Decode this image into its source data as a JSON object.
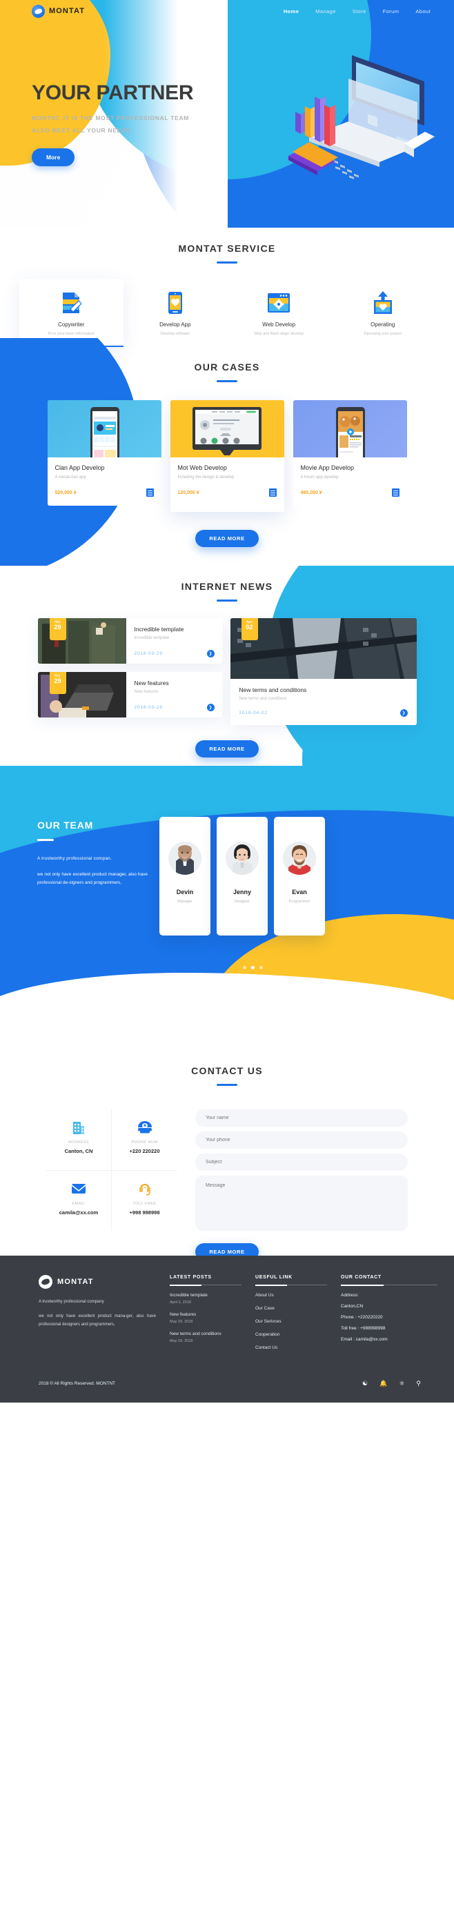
{
  "nav": {
    "brand": "MONTAT",
    "links": [
      {
        "label": "Home",
        "active": true
      },
      {
        "label": "Manage",
        "active": false
      },
      {
        "label": "Store",
        "active": false
      },
      {
        "label": "Forum",
        "active": false
      },
      {
        "label": "About",
        "active": false
      }
    ]
  },
  "hero": {
    "title": "YOUR PARTNER",
    "sub_line1": "MONTNT, IT IS THE MOST PROFESSIONAL TEAM",
    "sub_line2": "ALSO MEET ALL YOUR NEEDS",
    "button": "More"
  },
  "service": {
    "title": "MONTAT SERVICE",
    "items": [
      {
        "name": "Copywriter",
        "desc": "Fil in your basic information",
        "icon": "document-pencil-icon",
        "active": true
      },
      {
        "name": "Develop App",
        "desc": "Develop software",
        "icon": "mobile-heart-icon",
        "active": false
      },
      {
        "name": "Web Develop",
        "desc": "Web and Back-stage develop",
        "icon": "browser-gear-icon",
        "active": false
      },
      {
        "name": "Operating",
        "desc": "Operating your project",
        "icon": "upload-heart-icon",
        "active": false
      }
    ]
  },
  "cases": {
    "title": "OUR CASES",
    "read_more": "READ MORE",
    "items": [
      {
        "title": "Clan App Develop",
        "desc": "A social-clan app",
        "price": "520,000 ¥",
        "bg": "#4ab8e8",
        "feature": false
      },
      {
        "title": "Mot Web Develop",
        "desc": "Including the design & develop",
        "price": "120,000 ¥",
        "bg": "#fcc42a",
        "feature": true
      },
      {
        "title": "Movie App Develop",
        "desc": "A forum app develop",
        "price": "480,000 ¥",
        "bg": "#7b9cf0",
        "feature": false
      }
    ]
  },
  "news": {
    "title": "INTERNET NEWS",
    "read_more": "READ MORE",
    "small": [
      {
        "title": "Incredible template",
        "desc": "Incredible template",
        "date": "2018-03-29",
        "tag_month": "Mar",
        "tag_day": "29"
      },
      {
        "title": "New features",
        "desc": "New features",
        "date": "2018-03-29",
        "tag_month": "Mar",
        "tag_day": "29"
      }
    ],
    "big": {
      "title": "New terms and conditions",
      "desc": "New terms and conditions",
      "date": "2018-04-02",
      "tag_month": "Apri",
      "tag_day": "02"
    }
  },
  "team": {
    "title": "OUR TEAM",
    "p1": "A trustworthy professional compan.",
    "p2": "we not only have excellent product manager, also have professional de-signers and programmers,",
    "members": [
      {
        "name": "Devin",
        "role": "Manager"
      },
      {
        "name": "Jenny",
        "role": "Designer"
      },
      {
        "name": "Evan",
        "role": "Programmer"
      }
    ],
    "dots": [
      false,
      true,
      false
    ]
  },
  "contact": {
    "title": "CONTACT US",
    "info": [
      {
        "label": "ADDRESS",
        "value": "Canton, CN",
        "icon": "building-icon",
        "color": "#4ab8e8"
      },
      {
        "label": "PHONE NUM",
        "value": "+220 220220",
        "icon": "telephone-icon",
        "color": "#1a73e8"
      },
      {
        "label": "EMAIL",
        "value": "camila@xx.com",
        "icon": "envelope-icon",
        "color": "#1a73e8"
      },
      {
        "label": "TOLL FREE",
        "value": "+998 998998",
        "icon": "headset-icon",
        "color": "#f5a623"
      }
    ],
    "form": {
      "name_placeholder": "Your name",
      "phone_placeholder": "Your phone",
      "subject_placeholder": "Subject",
      "message_placeholder": "Message",
      "submit": "READ MORE"
    }
  },
  "footer": {
    "brand": "MONTAT",
    "p1": "A trustworthy professional company",
    "p2": "we not only have excellent product mana-ger, also have professional designers and programmers,",
    "latest_posts_title": "LATEST POSTS",
    "latest_posts": [
      {
        "title": "Incredible template",
        "date": "April 2, 2018"
      },
      {
        "title": "New features",
        "date": "May 29, 2018"
      },
      {
        "title": "New terms and conditions",
        "date": "May 29, 2018"
      }
    ],
    "useful_link_title": "UESFUL LINK",
    "useful_links": [
      "About Us",
      "Our Case",
      "Our Serivces",
      "Cooperation",
      "Contact Us"
    ],
    "contact_title": "OUR CONTACT",
    "contact_lines": [
      "Address:",
      "Canton,CN",
      "Phone : +220220220",
      "Toll free : +998998998",
      "Email : camila@xx.com"
    ],
    "copyright": "2018 © All Rights Reserved.   MONTNT",
    "social": [
      "wechat-icon",
      "bell-icon",
      "weibo-icon",
      "search-icon"
    ]
  },
  "colors": {
    "blue": "#1a73e8",
    "cyan": "#29b6e8",
    "yellow": "#fcc42a",
    "orange": "#f5a623",
    "dark": "#3b3f45"
  }
}
